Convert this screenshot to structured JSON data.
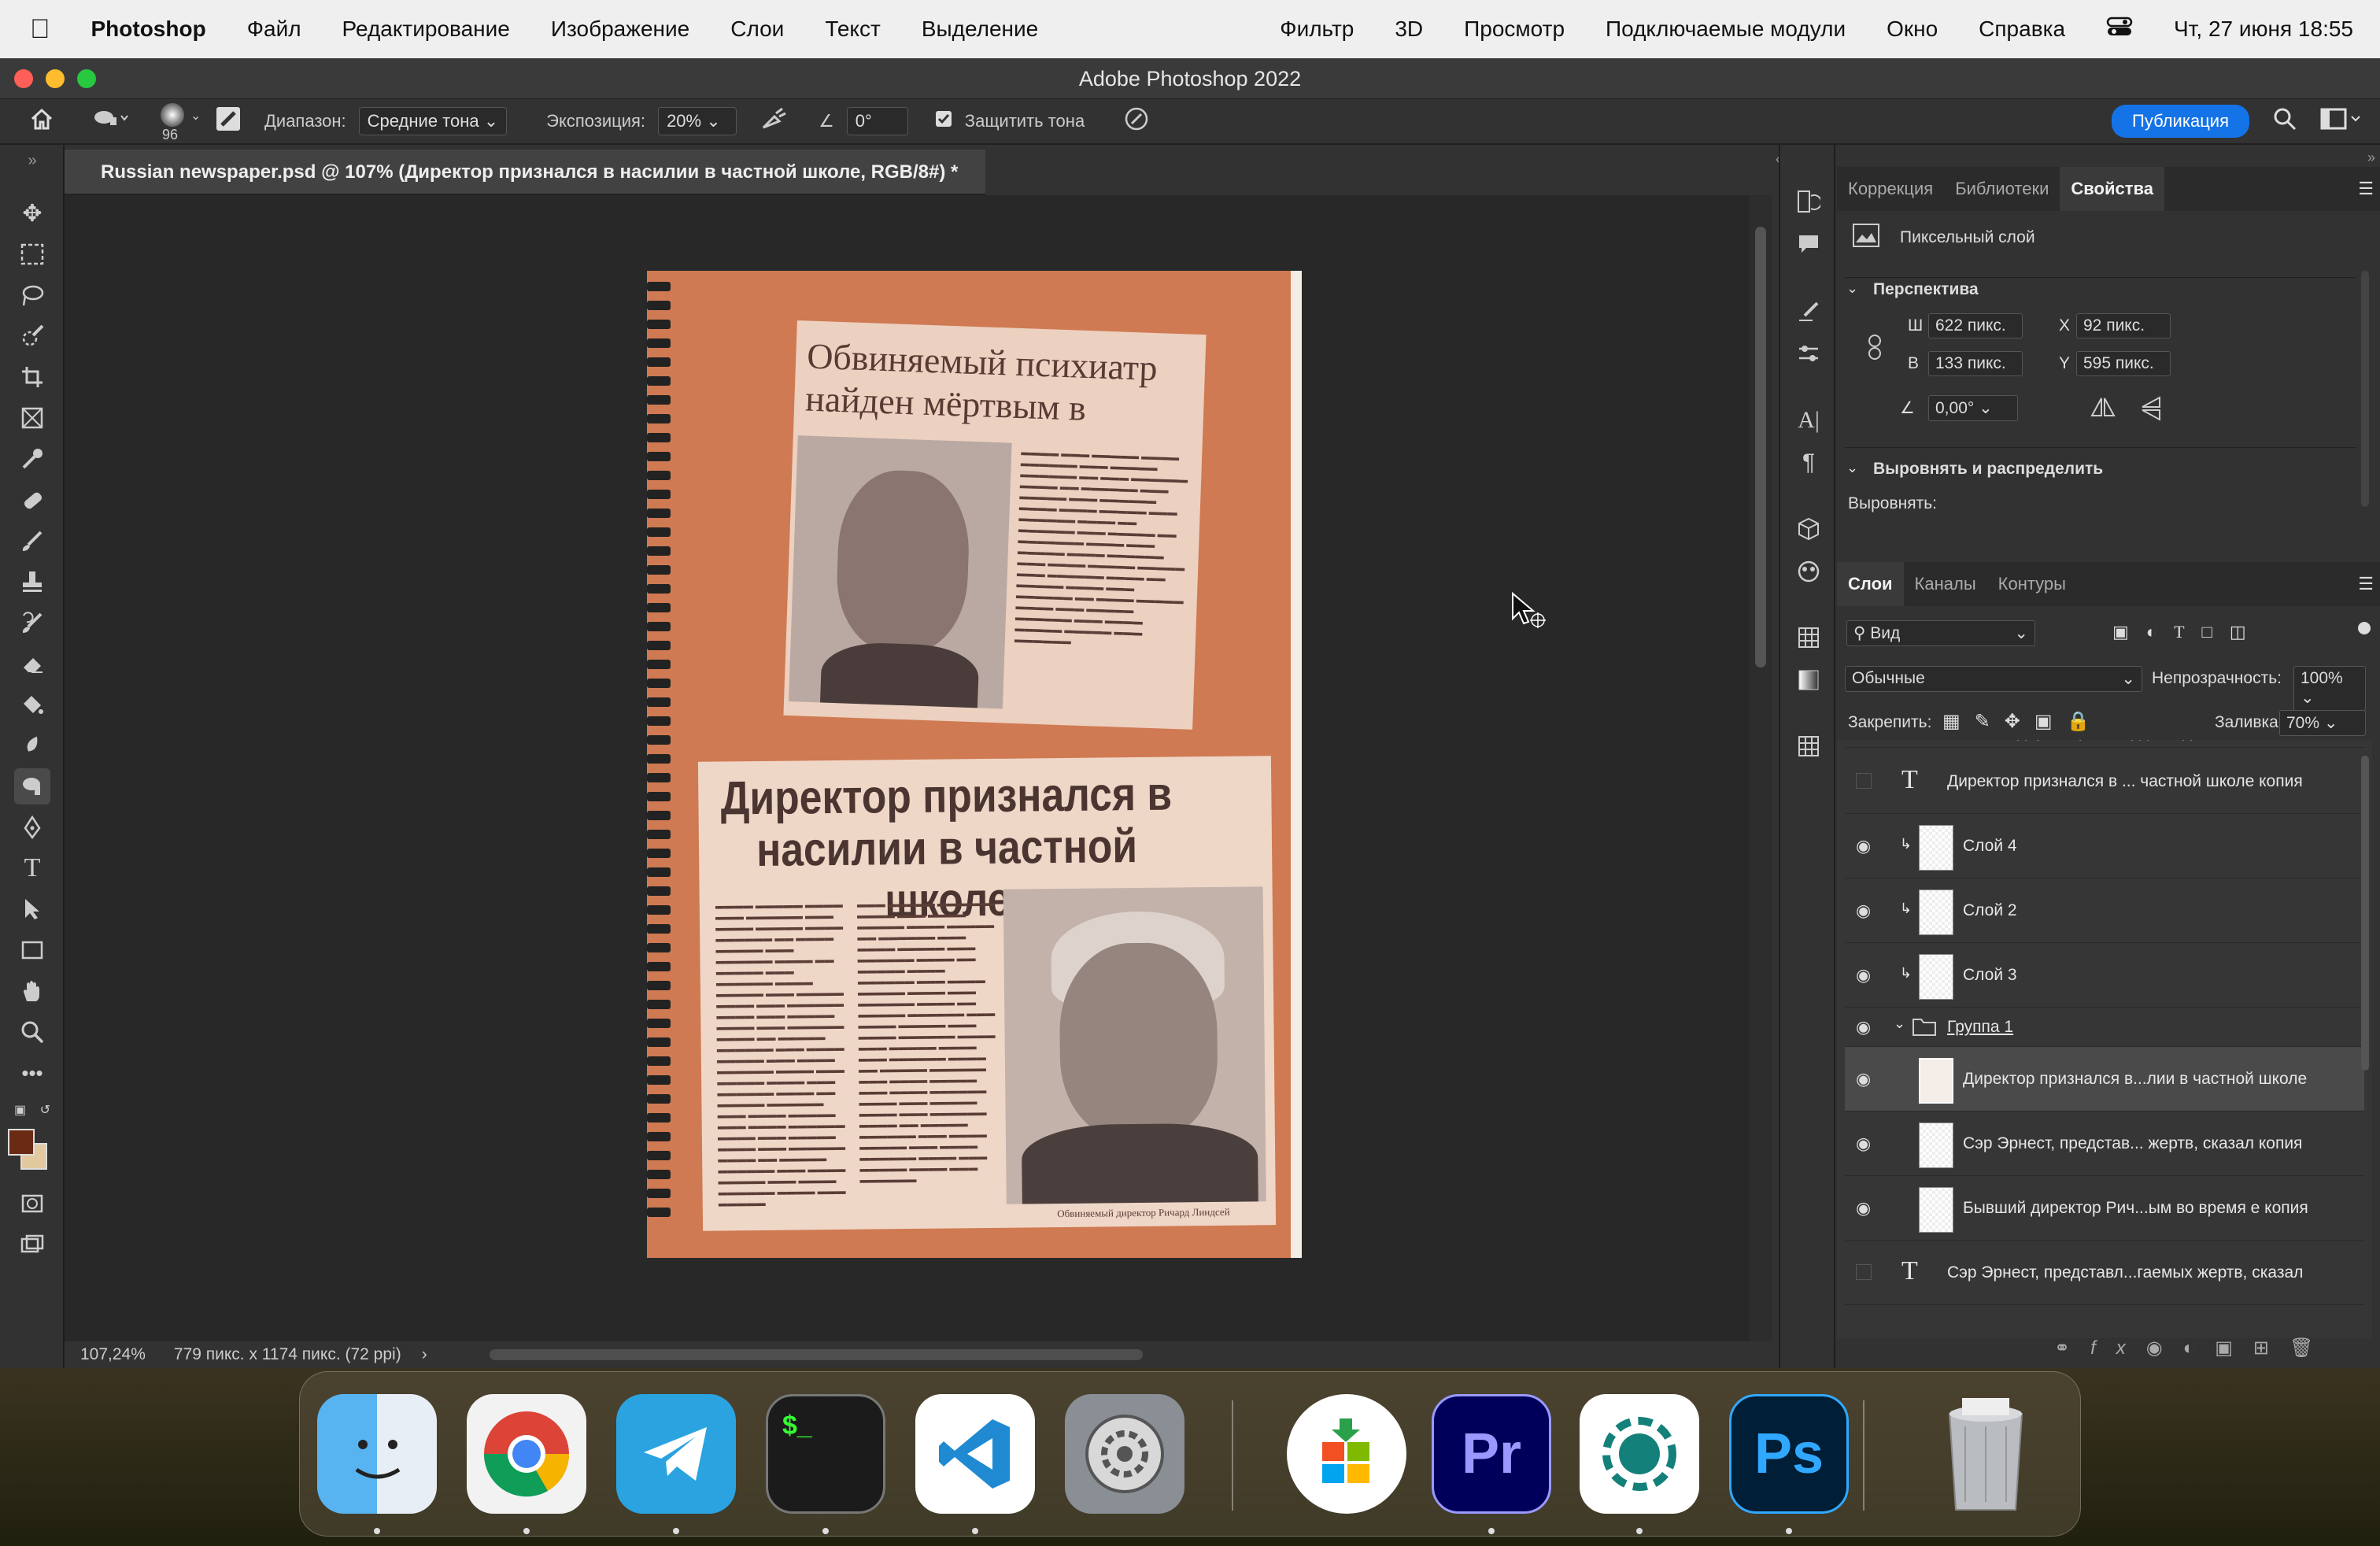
{
  "menubar": {
    "apple_icon": "apple-logo",
    "app": "Photoshop",
    "items": [
      "Файл",
      "Редактирование",
      "Изображение",
      "Слои",
      "Текст",
      "Выделение",
      "Фильтр",
      "3D",
      "Просмотр",
      "Подключаемые модули",
      "Окно",
      "Справка"
    ],
    "clock": "Чт, 27 июня  18:55"
  },
  "window": {
    "title": "Adobe Photoshop 2022"
  },
  "options": {
    "brush_size": "96",
    "range_label": "Диапазон:",
    "range_value": "Средние тона",
    "exposure_label": "Экспозиция:",
    "exposure_value": "20%",
    "angle_value": "0°",
    "protect_label": "Защитить тона",
    "publish_label": "Публикация"
  },
  "document": {
    "tab_title": "Russian newspaper.psd @ 107% (Директор признался в насилии в частной школе, RGB/8#) *",
    "zoom": "107,24%",
    "size_info": "779 пикс. x 1174 пикс. (72 ppi)",
    "clip1_headline": "Обвиняемый     психиатр найден мёртвым в камере",
    "clip2_headline": "Директор признался в насилии в частной школе",
    "clip2_caption": "Обвиняемый директор Ричард Линдсей"
  },
  "properties_panel": {
    "tabs": [
      "Коррекция",
      "Библиотеки",
      "Свойства"
    ],
    "layer_type": "Пиксельный слой",
    "section_perspective": "Перспектива",
    "w_label": "Ш",
    "w_value": "622 пикс.",
    "h_label": "В",
    "h_value": "133 пикс.",
    "x_label": "X",
    "x_value": "92 пикс.",
    "y_label": "Y",
    "y_value": "595 пикс.",
    "angle_value": "0,00°",
    "section_align": "Выровнять и распределить",
    "align_label": "Выровнять:"
  },
  "layers_panel": {
    "tabs": [
      "Слои",
      "Каналы",
      "Контуры"
    ],
    "filter_value": "Вид",
    "blend_mode": "Обычные",
    "opacity_label": "Непрозрачность:",
    "opacity_value": "100%",
    "lock_label": "Закрепить:",
    "fill_label": "Заливка:",
    "fill_value": "70%",
    "partial_layer": "Обвиняемый директор Ричард Линдсей",
    "layers": [
      {
        "name": "Директор признался в ... частной школе копия",
        "kind": "text",
        "visible": false
      },
      {
        "name": "Слой 4",
        "kind": "pixel",
        "visible": true
      },
      {
        "name": "Слой 2",
        "kind": "pixel",
        "visible": true
      },
      {
        "name": "Слой 3",
        "kind": "pixel",
        "visible": true
      },
      {
        "name": "Группа 1",
        "kind": "group",
        "visible": true
      },
      {
        "name": "Директор признался в...лии в частной школе",
        "kind": "pixel",
        "visible": true
      },
      {
        "name": "Сэр Эрнест, представ... жертв, сказал копия",
        "kind": "pixel",
        "visible": true
      },
      {
        "name": "Бывший директор Рич...ым во время е копия",
        "kind": "pixel",
        "visible": true
      },
      {
        "name": "Сэр Эрнест, представл...гаемых жертв, сказал",
        "kind": "text",
        "visible": false
      }
    ]
  },
  "dock": {
    "apps": [
      "Finder",
      "Chrome",
      "Telegram",
      "Terminal",
      "VS Code",
      "System Settings",
      "Microsoft Store",
      "Premiere Pro",
      "Screenshot",
      "Photoshop",
      "Trash"
    ],
    "pr_label": "Pr",
    "ps_label": "Ps"
  },
  "colors": {
    "accent": "#1473e6",
    "foreground": "#6b2a14",
    "background": "#e2c9a0"
  }
}
